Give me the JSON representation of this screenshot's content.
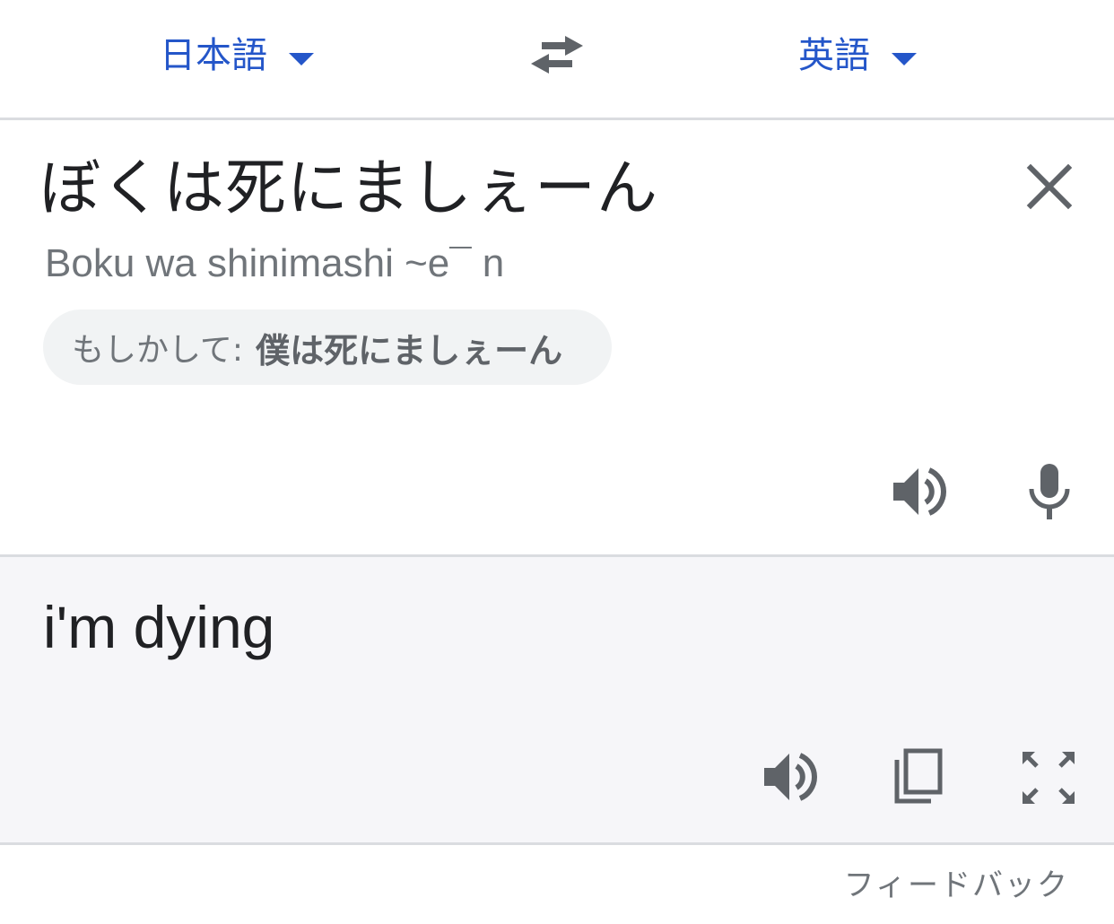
{
  "language_bar": {
    "source_language": "日本語",
    "target_language": "英語",
    "swap_icon": "swap-arrows-icon",
    "accent_color": "#2456c9"
  },
  "source": {
    "text": "ぼくは死にましぇーん",
    "romanization": "Boku wa shinimashi ~e¯ n",
    "suggestion_label": "もしかして:",
    "suggestion_text": "僕は死にましぇーん",
    "icons": [
      "close-icon",
      "speaker-icon",
      "microphone-icon"
    ]
  },
  "result": {
    "text": "i'm dying",
    "icons": [
      "speaker-icon",
      "copy-icon",
      "fullscreen-icon"
    ]
  },
  "footer": {
    "feedback_label": "フィードバック"
  }
}
